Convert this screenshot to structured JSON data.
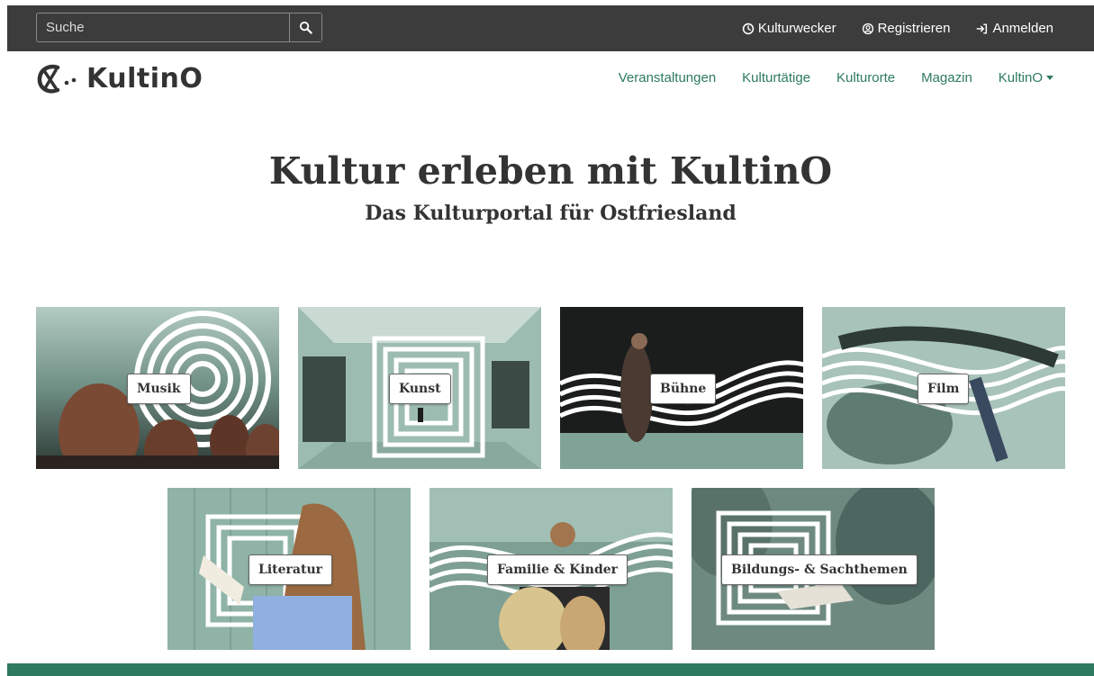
{
  "topbar": {
    "search_placeholder": "Suche",
    "search_icon": "search-icon",
    "links": [
      {
        "label": "Kulturwecker",
        "icon": "clock-icon"
      },
      {
        "label": "Registrieren",
        "icon": "user-circle-icon"
      },
      {
        "label": "Anmelden",
        "icon": "sign-in-icon"
      }
    ]
  },
  "header": {
    "logo_text": "KultinO",
    "nav": [
      {
        "label": "Veranstaltungen"
      },
      {
        "label": "Kulturtätige"
      },
      {
        "label": "Kulturorte"
      },
      {
        "label": "Magazin"
      },
      {
        "label": "KultinO",
        "dropdown": true
      }
    ]
  },
  "hero": {
    "title": "Kultur erleben mit KultinO",
    "subtitle": "Das Kulturportal für Ostfriesland"
  },
  "categories": [
    {
      "label": "Musik",
      "motif": "circles"
    },
    {
      "label": "Kunst",
      "motif": "squares"
    },
    {
      "label": "Bühne",
      "motif": "waves"
    },
    {
      "label": "Film",
      "motif": "waves"
    },
    {
      "label": "Literatur",
      "motif": "squares"
    },
    {
      "label": "Familie & Kinder",
      "motif": "waves"
    },
    {
      "label": "Bildungs- & Sachthemen",
      "motif": "squares"
    }
  ],
  "colors": {
    "topbar": "#3c3c3c",
    "accent": "#2d7a60",
    "tint": "#8fb3a6"
  }
}
